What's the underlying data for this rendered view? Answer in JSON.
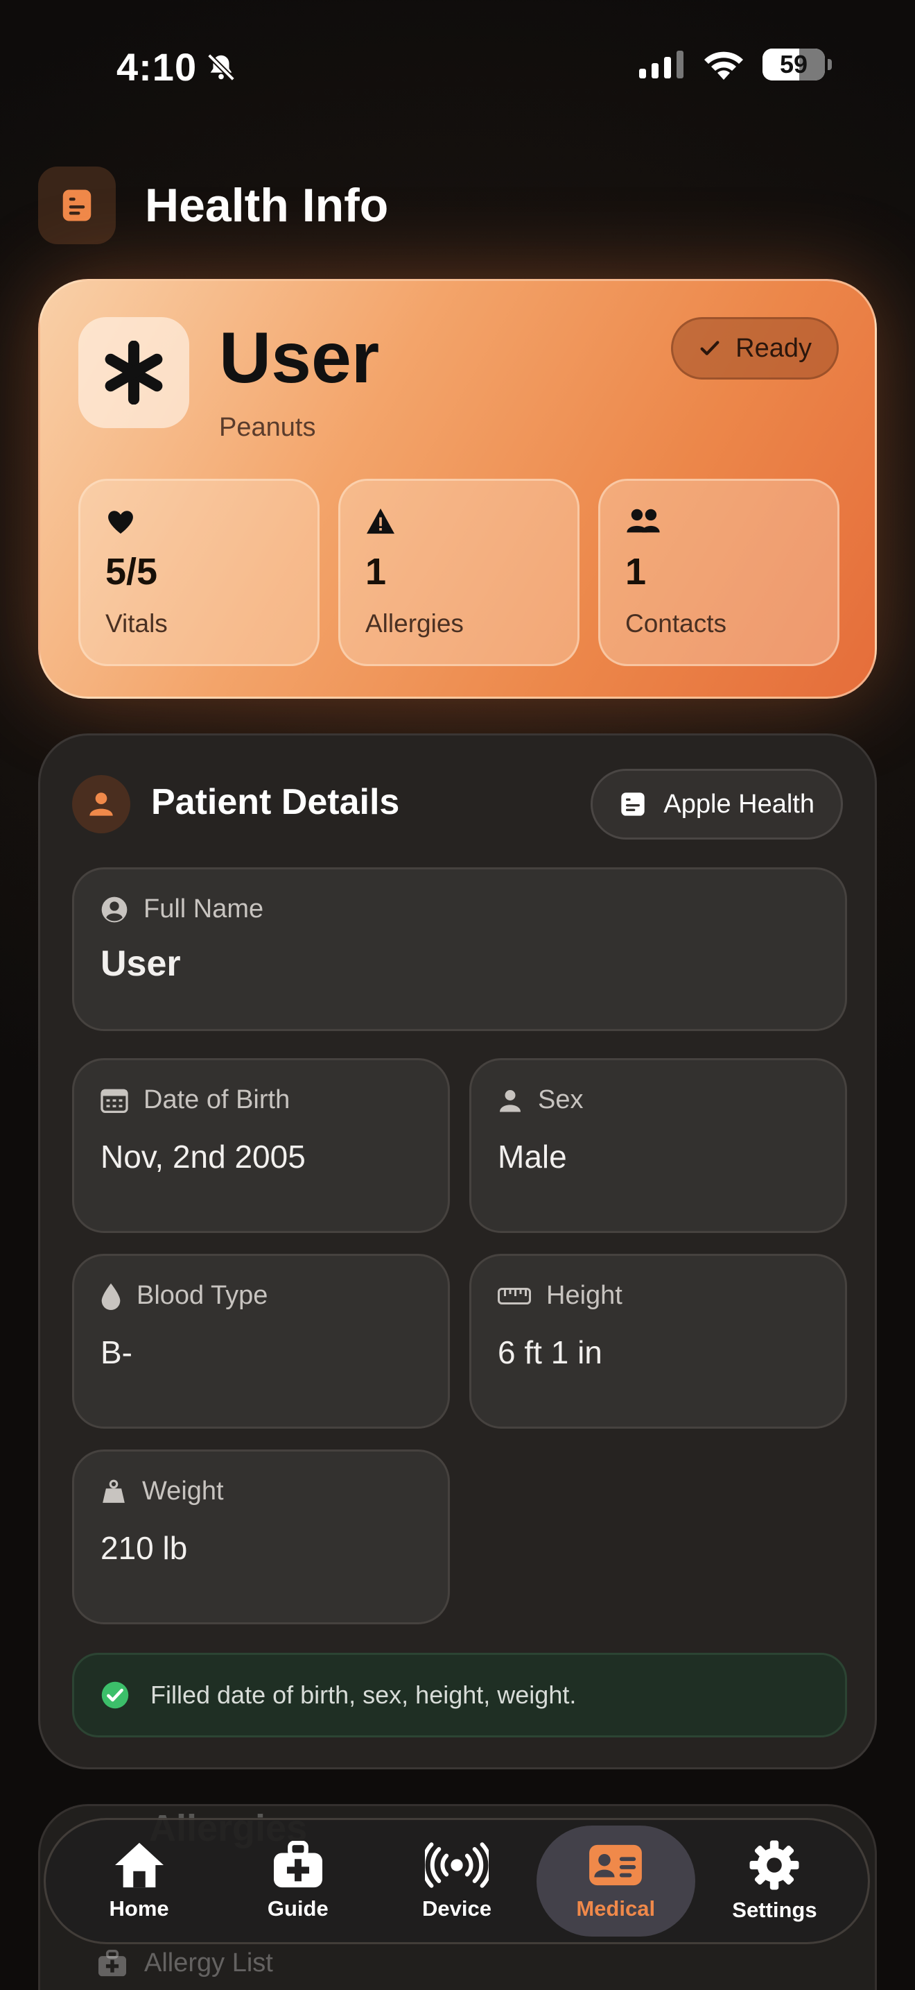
{
  "status_bar": {
    "time": "4:10",
    "battery": "59"
  },
  "header": {
    "title": "Health Info"
  },
  "hero": {
    "name": "User",
    "subtitle": "Peanuts",
    "badge": "Ready",
    "stats": [
      {
        "value": "5/5",
        "label": "Vitals",
        "icon": "heart-icon"
      },
      {
        "value": "1",
        "label": "Allergies",
        "icon": "warning-icon"
      },
      {
        "value": "1",
        "label": "Contacts",
        "icon": "people-icon"
      }
    ]
  },
  "patient": {
    "title": "Patient Details",
    "apple_health": "Apple Health",
    "fields": {
      "full_name": {
        "label": "Full Name",
        "value": "User"
      },
      "dob": {
        "label": "Date of Birth",
        "value": "Nov, 2nd 2005"
      },
      "sex": {
        "label": "Sex",
        "value": "Male"
      },
      "blood": {
        "label": "Blood Type",
        "value": "B-"
      },
      "height": {
        "label": "Height",
        "value": "6 ft 1 in"
      },
      "weight": {
        "label": "Weight",
        "value": "210 lb"
      }
    },
    "note": "Filled date of birth, sex, height, weight."
  },
  "peek": {
    "title_a": "Allergies",
    "title_b": "Allergies",
    "item": "Allergy List"
  },
  "tabs": [
    {
      "label": "Home",
      "icon": "house-icon"
    },
    {
      "label": "Guide",
      "icon": "first-aid-kit-icon"
    },
    {
      "label": "Device",
      "icon": "broadcast-icon"
    },
    {
      "label": "Medical",
      "icon": "id-card-icon",
      "active": true
    },
    {
      "label": "Settings",
      "icon": "gear-icon"
    }
  ],
  "colors": {
    "accent": "#f0894a",
    "success": "#3cbf6a"
  }
}
